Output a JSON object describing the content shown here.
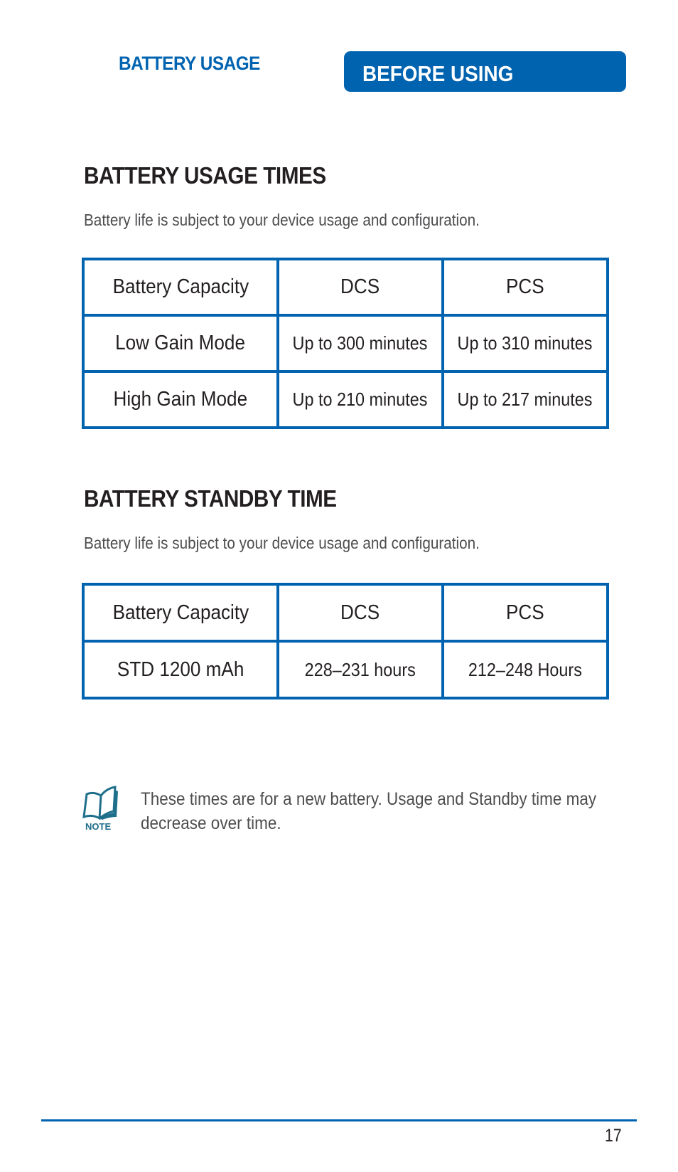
{
  "header": {
    "section_label": "BATTERY USAGE",
    "chapter_title": "BEFORE USING",
    "accent_color": "#0063b0"
  },
  "usage_times": {
    "heading": "BATTERY USAGE TIMES",
    "subtext": "Battery life is subject to your device usage and configuration.",
    "columns": [
      "Battery Capacity",
      "DCS",
      "PCS"
    ],
    "rows": [
      {
        "label": "Low Gain Mode",
        "dcs": "Up to 300 minutes",
        "pcs": "Up to 310 minutes"
      },
      {
        "label": "High Gain Mode",
        "dcs": "Up to 210 minutes",
        "pcs": "Up to 217 minutes"
      }
    ]
  },
  "standby_time": {
    "heading": "BATTERY STANDBY TIME",
    "subtext": "Battery life is subject to your device usage and configuration.",
    "columns": [
      "Battery Capacity",
      "DCS",
      "PCS"
    ],
    "rows": [
      {
        "label": "STD 1200 mAh",
        "dcs": "228–231 hours",
        "pcs": "212–248 Hours"
      }
    ]
  },
  "note": {
    "icon": "note-book-icon",
    "icon_label": "NOTE",
    "text": "These times are for a new battery. Usage and Standby time may decrease over time."
  },
  "footer": {
    "page_number": "17"
  }
}
